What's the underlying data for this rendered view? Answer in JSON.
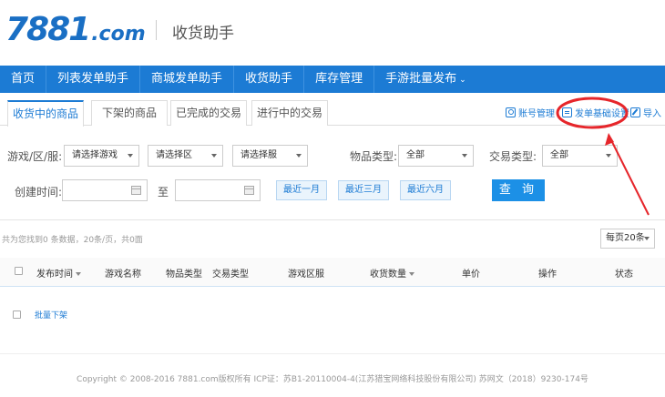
{
  "header": {
    "logo_number": "7881",
    "logo_domain": ".com",
    "title": "收货助手"
  },
  "nav": {
    "items": [
      {
        "label": "首页"
      },
      {
        "label": "列表发单助手"
      },
      {
        "label": "商城发单助手"
      },
      {
        "label": "收货助手"
      },
      {
        "label": "库存管理"
      },
      {
        "label": "手游批量发布"
      }
    ],
    "dropdown_caret": "⌄"
  },
  "tabs": [
    {
      "label": "收货中的商品",
      "active": true
    },
    {
      "label": "下架的商品",
      "active": false
    },
    {
      "label": "已完成的交易",
      "active": false
    },
    {
      "label": "进行中的交易",
      "active": false
    }
  ],
  "tools": {
    "account_manage": "账号管理",
    "order_base_settings": "发单基础设置",
    "import": "导入"
  },
  "filters": {
    "game_server_label": "游戏/区/服:",
    "game_select": "请选择游戏",
    "area_select": "请选择区",
    "server_select": "请选择服",
    "item_type_label": "物品类型:",
    "item_type_value": "全部",
    "trade_type_label": "交易类型:",
    "trade_type_value": "全部",
    "created_time_label": "创建时间:",
    "to_label": "至",
    "quick_ranges": [
      "最近一月",
      "最近三月",
      "最近六月"
    ],
    "search_button": "查 询"
  },
  "results": {
    "summary": "共为您找到0 条数据，20条/页，共0面",
    "page_size": "每页20条"
  },
  "table": {
    "columns": [
      "发布时间",
      "游戏名称",
      "物品类型",
      "交易类型",
      "游戏区服",
      "收货数量",
      "单价",
      "操作",
      "状态"
    ],
    "batch_action": "批量下架"
  },
  "footer": {
    "copyright": "Copyright © 2008-2016 7881.com版权所有 ICP证：苏B1-20110004-4(江苏猎宝网络科技股份有限公司) 苏网文（2018）9230-174号"
  },
  "colors": {
    "nav_bg": "#1c7bd4",
    "accent": "#1c7bd4",
    "annotation_red": "#e6262b"
  }
}
